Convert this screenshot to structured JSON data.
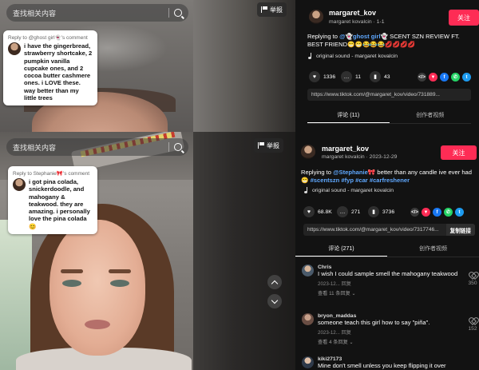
{
  "search": {
    "placeholder": "查找相关内容"
  },
  "report_label": "举报",
  "video_top": {
    "reply_head": "Reply to @ghost girl👻's comment",
    "reply_text": "i have the gingerbread, strawberry shortcake, 2 pumpkin vanilla cupcake ones, and 2 cocoa butter cashmere ones. i LOVE these. way better than my little trees"
  },
  "video_bottom": {
    "reply_head": "Reply to Stephanie🎀's comment",
    "reply_text": "i got pina colada, snickerdoodle, and mahogany & teakwood. they are amazing. i personally love the pina colada😊"
  },
  "panel_top": {
    "author": "margaret_kov",
    "sub": "margaret kovalcin · 1-1",
    "follow": "关注",
    "desc_prefix": "Replying to ",
    "desc_mention": "@👻ghost girl👻",
    "desc_rest": " SCENT SZN REVIEW FT. BEST FRIEND😁😁😂😂😂💋💋💋💋",
    "music": "original sound - margaret kovalcin",
    "stats": {
      "likes": "1336",
      "comments": "11",
      "saves": "43"
    },
    "link": "https://www.tiktok.com/@margaret_kov/video/731889...",
    "tab_comments": "评论 (11)",
    "tab_creator": "创作者视频"
  },
  "panel_bottom": {
    "author": "margaret_kov",
    "sub": "margaret kovalcin · 2023-12-29",
    "follow": "关注",
    "desc_prefix": "Replying to ",
    "desc_mention": "@Stephanie🎀",
    "desc_rest": " better than any candle ive ever had😁 ",
    "desc_tags": "#scentszn #fyp #car #carfreshener",
    "music": "original sound - margaret kovalcin",
    "stats": {
      "likes": "68.8K",
      "comments": "271",
      "saves": "3736"
    },
    "link": "https://www.tiktok.com/@margaret_kov/video/7317746...",
    "copy": "复制链接",
    "tab_comments": "评论 (271)",
    "tab_creator": "创作者视频",
    "comments": [
      {
        "name": "Chris",
        "text": "I wish I could sample smell the mahogany teakwood",
        "meta": "2023-12... 回复",
        "more": "查看 11 条回复 ⌄",
        "likes": "350"
      },
      {
        "name": "bryon_maddas",
        "text": "someone teach this girl how to say \"piña\".",
        "meta": "2023-12... 回复",
        "more": "查看 4 条回复 ⌄",
        "likes": "152"
      },
      {
        "name": "kiki27173",
        "text": "Mine don't smell unless you keep flipping it over",
        "meta": "",
        "more": "",
        "likes": ""
      }
    ]
  },
  "share_colors": {
    "embed": "#3a3a3a",
    "tiktok": "#fe2c55",
    "facebook": "#1877f2",
    "whatsapp": "#25d366",
    "twitter": "#1d9bf0"
  }
}
